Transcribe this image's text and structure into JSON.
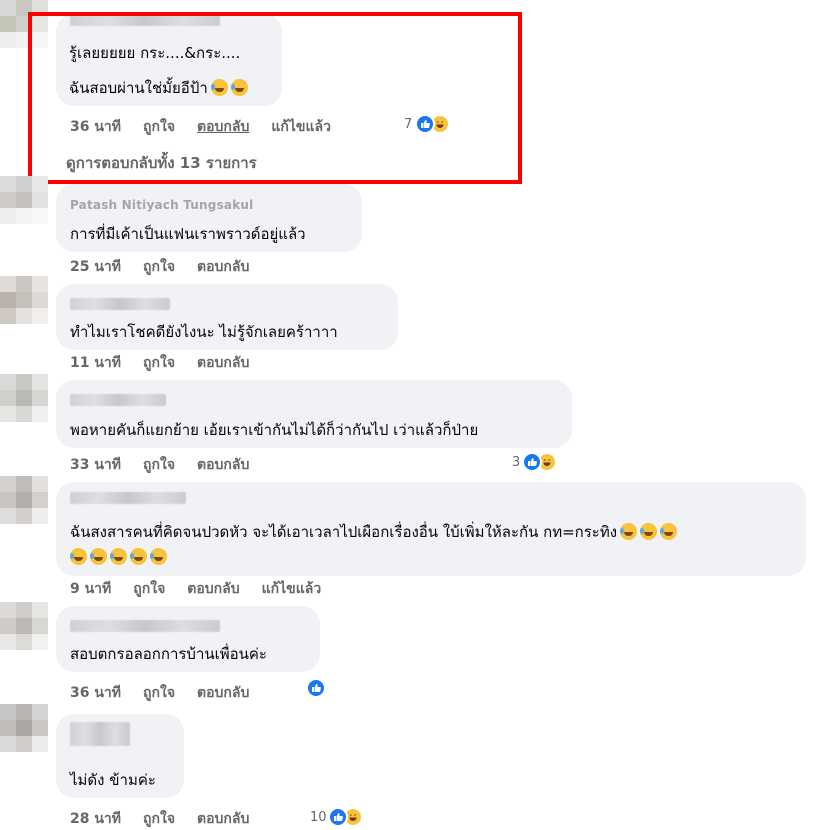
{
  "comments": [
    {
      "author": "Nuengruthai Kaeosai",
      "lines": [
        "รู้เลยยยยย กระ....&กระ....",
        "ฉันสอบผ่านใช่มั้ยอีป้า"
      ],
      "time": "36 นาที",
      "like": "ถูกใจ",
      "reply": "ตอบกลับ",
      "edited": "แก้ไขแล้ว",
      "reaction_count": "7",
      "view_replies": "ดูการตอบกลับทั้ง 13 รายการ"
    },
    {
      "author": "Patash Nitiyach Tungsakul",
      "lines": [
        "การที่มีเค้าเป็นแฟนเราพราวด์อยู่แล้ว"
      ],
      "time": "25 นาที",
      "like": "ถูกใจ",
      "reply": "ตอบกลับ"
    },
    {
      "author": "Kanokwan Supanan",
      "lines": [
        "ทำไมเราโชคดียังไงนะ ไม่รู้จักเลยคร้าาาา"
      ],
      "time": "11 นาที",
      "like": "ถูกใจ",
      "reply": "ตอบกลับ"
    },
    {
      "author": "Siriporn Jupon",
      "lines": [
        "พอหายคันก็แยกย้าย เอ้ยเราเข้ากันไม่ได้ก็ว่ากันไป เว่าแล้วก็ป่าย"
      ],
      "time": "33 นาที",
      "like": "ถูกใจ",
      "reply": "ตอบกลับ",
      "reaction_count": "3"
    },
    {
      "author": "Suwanna Jampasri",
      "lines": [
        "ฉันสงสารคนที่คิดจนปวดหัว จะได้เอาเวลาไปเผือกเรื่องอื่น ใบ้เพิ่มให้ละกัน กท=กระทิง"
      ],
      "time": "9 นาที",
      "like": "ถูกใจ",
      "reply": "ตอบกลับ",
      "edited": "แก้ไขแล้ว"
    },
    {
      "author": "Wanida Kaewjaroen",
      "lines": [
        "สอบตกรอลอกการบ้านเพื่อนค่ะ"
      ],
      "time": "36 นาที",
      "like": "ถูกใจ",
      "reply": "ตอบกลับ"
    },
    {
      "author": "Noey Ying",
      "lines": [
        "ไม่ดัง ข้ามค่ะ"
      ],
      "time": "28 นาที",
      "like": "ถูกใจ",
      "reply": "ตอบกลับ",
      "reaction_count": "10"
    }
  ],
  "colors": {
    "highlight_border": "#ff0000",
    "bubble_bg": "#f0f2f5",
    "meta_text": "#65676b",
    "like_blue": "#1877f2",
    "emoji_yellow": "#f7c33a"
  },
  "icons": [
    "like-icon",
    "haha-icon",
    "tearful-laugh-emoji",
    "rolling-laugh-emoji"
  ]
}
